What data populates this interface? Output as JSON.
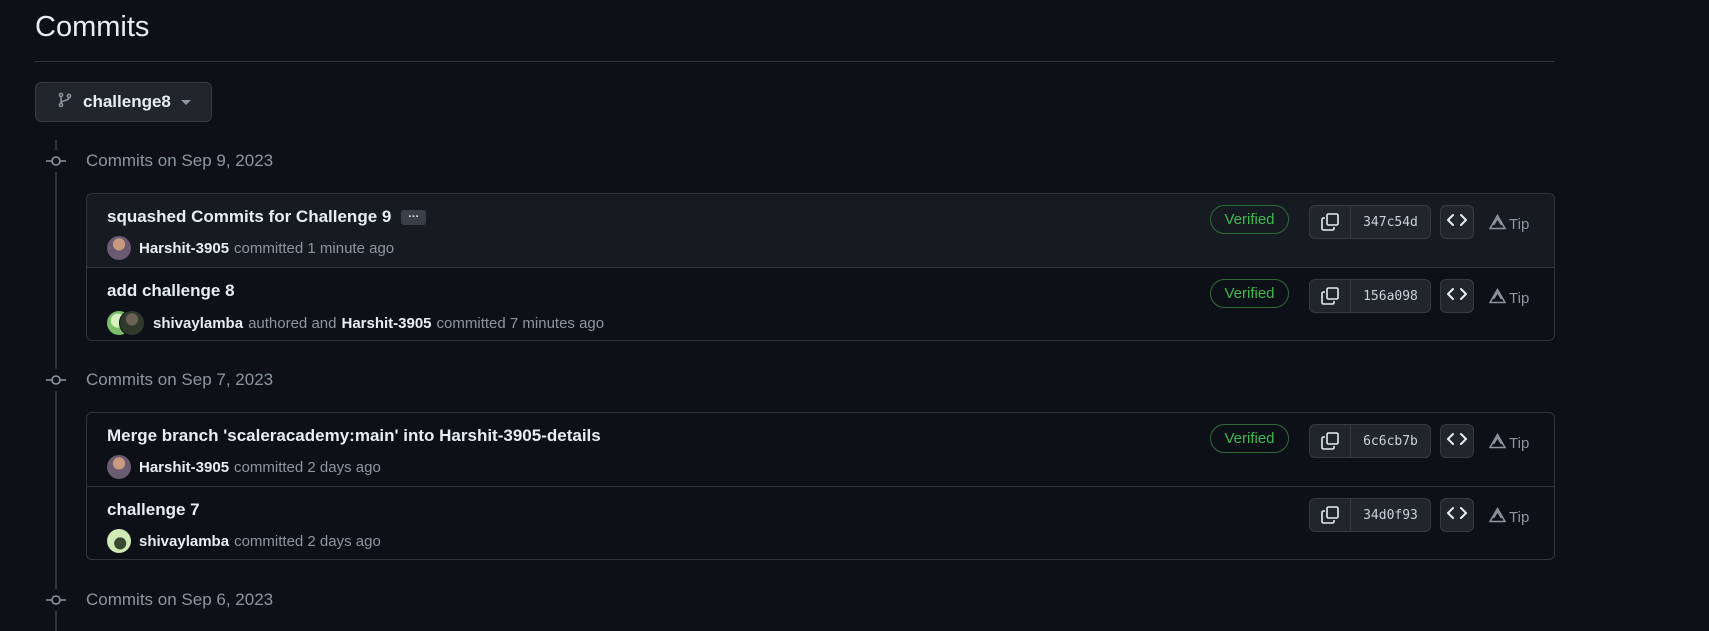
{
  "page": {
    "title": "Commits"
  },
  "branch": {
    "label": "challenge8"
  },
  "groups": [
    {
      "label": "Commits on Sep 9, 2023",
      "commits": [
        {
          "message": "squashed Commits for Challenge 9",
          "has_more": true,
          "ellipsis": "···",
          "author": "Harshit-3905",
          "author_text": "committed 1 minute ago",
          "verified": "Verified",
          "sha": "347c54d",
          "tip": "Tip"
        },
        {
          "message": "add challenge 8",
          "author": "shivaylamba",
          "author_text": "authored and",
          "committer": "Harshit-3905",
          "committer_text": "committed 7 minutes ago",
          "verified": "Verified",
          "sha": "156a098",
          "tip": "Tip"
        }
      ]
    },
    {
      "label": "Commits on Sep 7, 2023",
      "commits": [
        {
          "message": "Merge branch 'scaleracademy:main' into Harshit-3905-details",
          "author": "Harshit-3905",
          "author_text": "committed 2 days ago",
          "verified": "Verified",
          "sha": "6c6cb7b",
          "tip": "Tip"
        },
        {
          "message": "challenge 7",
          "author": "shivaylamba",
          "author_text": "committed 2 days ago",
          "sha": "34d0f93",
          "tip": "Tip"
        }
      ]
    },
    {
      "label": "Commits on Sep 6, 2023"
    }
  ],
  "colors": {
    "verified": "#3fb950",
    "background": "#0d1117",
    "border": "#30363d"
  }
}
